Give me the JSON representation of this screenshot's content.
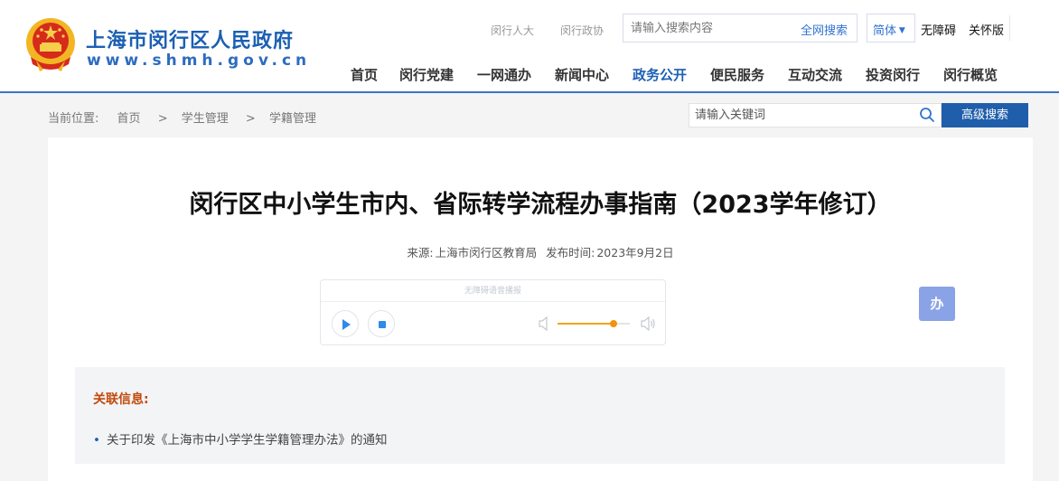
{
  "header": {
    "site_name": "上海市闵行区人民政府",
    "site_url": "www.shmh.gov.cn",
    "top_links": [
      "闵行人大",
      "闵行政协"
    ],
    "search": {
      "placeholder": "请输入搜索内容",
      "button": "全网搜索"
    },
    "language": "简体",
    "accessibility": [
      "无障碍",
      "关怀版"
    ],
    "nav": [
      "首页",
      "闵行党建",
      "一网通办",
      "新闻中心",
      "政务公开",
      "便民服务",
      "互动交流",
      "投资闵行",
      "闵行概览"
    ],
    "nav_active": "政务公开"
  },
  "breadcrumb": {
    "prefix": "当前位置:",
    "items": [
      "首页",
      "学生管理",
      "学籍管理"
    ],
    "separator": ">"
  },
  "keyword_search": {
    "placeholder": "请输入关键词",
    "button": "高级搜索"
  },
  "article": {
    "title": "闵行区中小学生市内、省际转学流程办事指南（2023学年修订）",
    "source_label": "来源:",
    "source": "上海市闵行区教育局",
    "date_label": "发布时间:",
    "date": "2023年9月2日"
  },
  "player": {
    "header": "无障碍语音播报",
    "volume": 0.78
  },
  "ban_button": "办",
  "related": {
    "title": "关联信息:",
    "items": [
      "关于印发《上海市中小学学生学籍管理办法》的通知"
    ]
  },
  "colors": {
    "primary": "#1c5fb3",
    "accent_orange": "#f5a316",
    "related_title": "#c24a0c"
  }
}
